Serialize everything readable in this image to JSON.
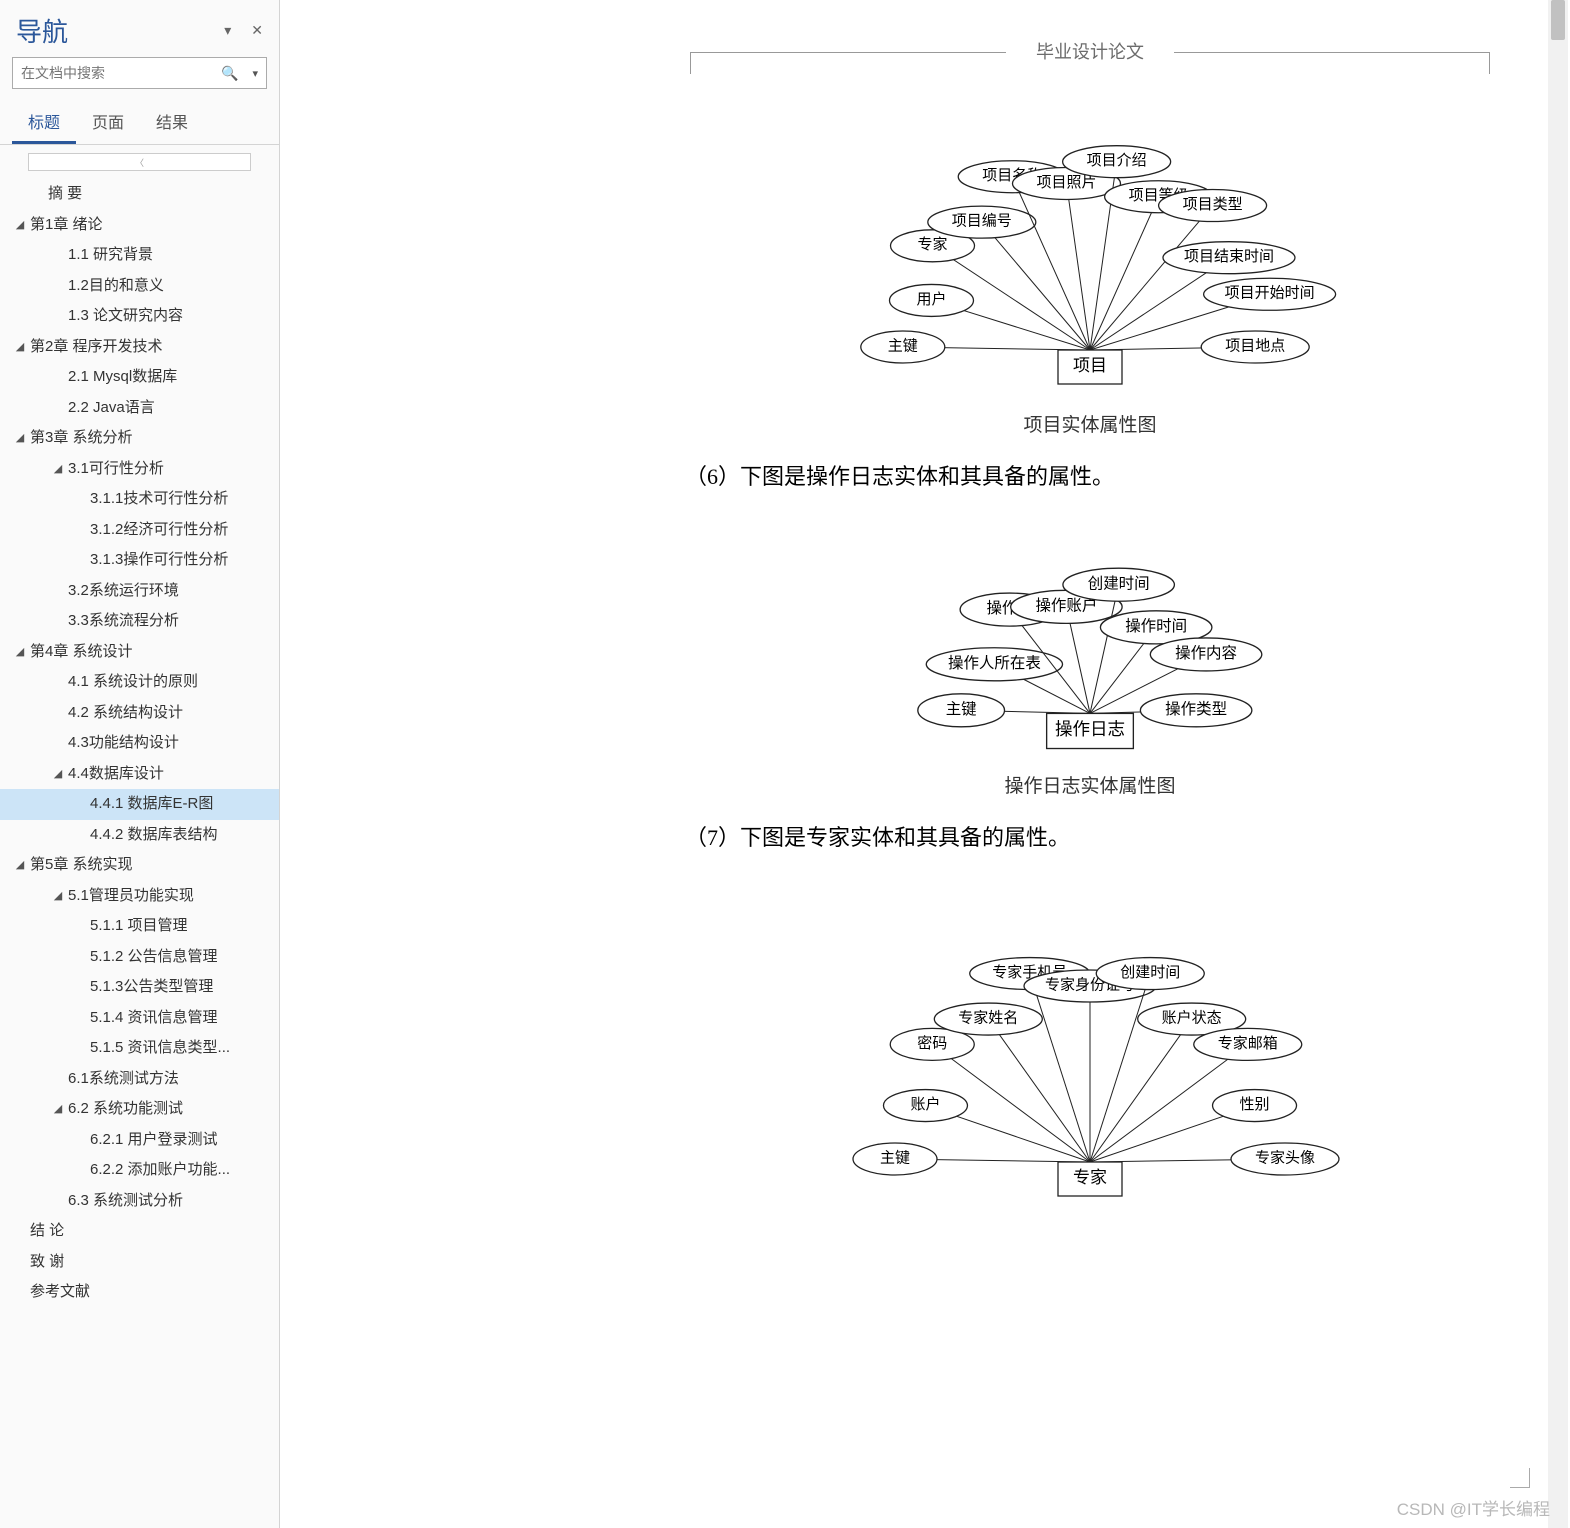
{
  "nav": {
    "title": "导航",
    "search_placeholder": "在文档中搜索",
    "tabs": {
      "headings": "标题",
      "pages": "页面",
      "results": "结果"
    },
    "outline": [
      {
        "lv": 1,
        "t": "摘 要",
        "tw": ""
      },
      {
        "lv": 0,
        "t": "第1章 绪论",
        "tw": "◢"
      },
      {
        "lv": 2,
        "t": "1.1 研究背景",
        "tw": ""
      },
      {
        "lv": 2,
        "t": "1.2目的和意义",
        "tw": ""
      },
      {
        "lv": 2,
        "t": "1.3 论文研究内容",
        "tw": ""
      },
      {
        "lv": 0,
        "t": "第2章 程序开发技术",
        "tw": "◢"
      },
      {
        "lv": 2,
        "t": "2.1 Mysql数据库",
        "tw": ""
      },
      {
        "lv": 2,
        "t": "2.2 Java语言",
        "tw": ""
      },
      {
        "lv": 0,
        "t": "第3章 系统分析",
        "tw": "◢"
      },
      {
        "lv": 2,
        "t": "3.1可行性分析",
        "tw": "◢"
      },
      {
        "lv": 3,
        "t": "3.1.1技术可行性分析",
        "tw": ""
      },
      {
        "lv": 3,
        "t": "3.1.2经济可行性分析",
        "tw": ""
      },
      {
        "lv": 3,
        "t": "3.1.3操作可行性分析",
        "tw": ""
      },
      {
        "lv": 2,
        "t": "3.2系统运行环境",
        "tw": ""
      },
      {
        "lv": 2,
        "t": "3.3系统流程分析",
        "tw": ""
      },
      {
        "lv": 0,
        "t": "第4章 系统设计",
        "tw": "◢"
      },
      {
        "lv": 2,
        "t": "4.1 系统设计的原则",
        "tw": ""
      },
      {
        "lv": 2,
        "t": "4.2 系统结构设计",
        "tw": ""
      },
      {
        "lv": 2,
        "t": "4.3功能结构设计",
        "tw": ""
      },
      {
        "lv": 2,
        "t": "4.4数据库设计",
        "tw": "◢"
      },
      {
        "lv": 3,
        "t": "4.4.1 数据库E-R图",
        "tw": "",
        "sel": true
      },
      {
        "lv": 3,
        "t": "4.4.2 数据库表结构",
        "tw": ""
      },
      {
        "lv": 0,
        "t": "第5章 系统实现",
        "tw": "◢"
      },
      {
        "lv": 2,
        "t": "5.1管理员功能实现",
        "tw": "◢"
      },
      {
        "lv": 3,
        "t": "5.1.1 项目管理",
        "tw": ""
      },
      {
        "lv": 3,
        "t": "5.1.2 公告信息管理",
        "tw": ""
      },
      {
        "lv": 3,
        "t": "5.1.3公告类型管理",
        "tw": ""
      },
      {
        "lv": 3,
        "t": "5.1.4 资讯信息管理",
        "tw": ""
      },
      {
        "lv": 3,
        "t": "5.1.5 资讯信息类型...",
        "tw": ""
      },
      {
        "lv": 2,
        "t": "6.1系统测试方法",
        "tw": ""
      },
      {
        "lv": 2,
        "t": "6.2 系统功能测试",
        "tw": "◢"
      },
      {
        "lv": 3,
        "t": "6.2.1 用户登录测试",
        "tw": ""
      },
      {
        "lv": 3,
        "t": "6.2.2 添加账户功能...",
        "tw": ""
      },
      {
        "lv": 2,
        "t": "6.3 系统测试分析",
        "tw": ""
      },
      {
        "lv": 0,
        "t": "结 论",
        "tw": ""
      },
      {
        "lv": 0,
        "t": "致 谢",
        "tw": ""
      },
      {
        "lv": 0,
        "t": "参考文献",
        "tw": ""
      }
    ]
  },
  "doc": {
    "header_title": "毕业设计论文",
    "fig1_caption": "项目实体属性图",
    "para6": "（6）下图是操作日志实体和其具备的属性。",
    "fig2_caption": "操作日志实体属性图",
    "para7": "（7）下图是专家实体和其具备的属性。",
    "er1": {
      "entity": "项目",
      "attrs": [
        "主键",
        "用户",
        "专家",
        "项目编号",
        "项目名称",
        "项目照片",
        "项目介绍",
        "项目等级",
        "项目类型",
        "项目结束时间",
        "项目开始时间",
        "项目地点"
      ]
    },
    "er2": {
      "entity": "操作日志",
      "attrs": [
        "主键",
        "操作人所在表",
        "操作表",
        "操作账户",
        "创建时间",
        "操作时间",
        "操作内容",
        "操作类型"
      ]
    },
    "er3": {
      "entity": "专家",
      "attrs": [
        "主键",
        "账户",
        "密码",
        "专家姓名",
        "专家手机号",
        "专家身份证号",
        "创建时间",
        "账户状态",
        "专家邮箱",
        "性别",
        "专家头像"
      ]
    }
  },
  "watermark": "CSDN @IT学长编程",
  "chart_data": [
    {
      "type": "er-diagram",
      "entity": "项目",
      "attributes": [
        "主键",
        "用户",
        "专家",
        "项目编号",
        "项目名称",
        "项目照片",
        "项目介绍",
        "项目等级",
        "项目类型",
        "项目结束时间",
        "项目开始时间",
        "项目地点"
      ]
    },
    {
      "type": "er-diagram",
      "entity": "操作日志",
      "attributes": [
        "主键",
        "操作人所在表",
        "操作表",
        "操作账户",
        "创建时间",
        "操作时间",
        "操作内容",
        "操作类型"
      ]
    },
    {
      "type": "er-diagram",
      "entity": "专家",
      "attributes": [
        "主键",
        "账户",
        "密码",
        "专家姓名",
        "专家手机号",
        "专家身份证号",
        "创建时间",
        "账户状态",
        "专家邮箱",
        "性别",
        "专家头像"
      ]
    }
  ]
}
